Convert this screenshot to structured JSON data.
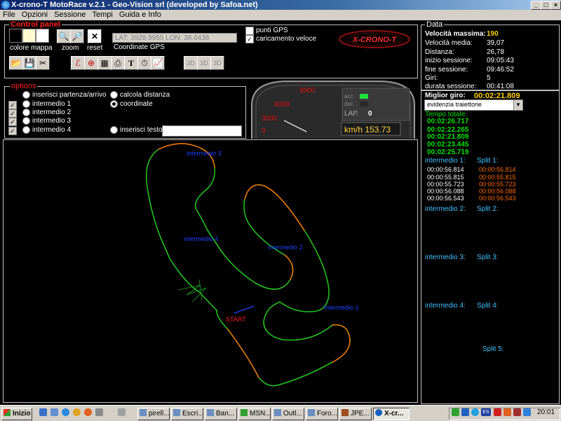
{
  "window": {
    "title": "X-crono-T MotoRace v.2.1 - Geo-Vision srl (developed by Safoa.net)"
  },
  "menu": [
    "File",
    "Opzioni",
    "Sessione",
    "Tempi",
    "Guida e Info"
  ],
  "control_panel": {
    "legend": "Control panel",
    "colore_mappa": "colore mappa",
    "zoom": "zoom",
    "reset": "reset",
    "coords_value": "LAT: 3928.9955 LON: 38.0438",
    "coords_label": "Coordinate GPS",
    "punti_gps": "punti GPS",
    "caricamento_veloce": "caricamento veloce",
    "swatch_colors": [
      "#000000",
      "#fffbd0",
      "#ffffff"
    ]
  },
  "options": {
    "legend": "options",
    "left": [
      "inserisci partenza/arrivo",
      "intermedio 1",
      "intermedio 2",
      "intermedio 3",
      "intermedio 4"
    ],
    "right": [
      "calcola distanza",
      "coordinate",
      "inserisci testo"
    ],
    "selected": "coordinate"
  },
  "gauge": {
    "scale": [
      "9000",
      "6000",
      "3000",
      "0"
    ],
    "acc": "acc",
    "dec": "dec",
    "lap_label": "LAP.",
    "lap_value": "0",
    "speed": "km/h 153.73"
  },
  "logo": "X-CRONO-T",
  "data": {
    "legend": "Data",
    "velocita_massima_label": "Velocità massima:",
    "velocita_massima": "190",
    "rows": [
      {
        "label": "Velocità media:",
        "value": "39,07"
      },
      {
        "label": "Distanza:",
        "value": "26,78"
      },
      {
        "label": "inizio sessione:",
        "value": "09:05:43"
      },
      {
        "label": "fine sessione:",
        "value": "09:46:52"
      },
      {
        "label": "Giri:",
        "value": "5"
      },
      {
        "label": "durata sessione:",
        "value": "00:41:08"
      }
    ],
    "miglior_giro_label": "Miglior giro:",
    "miglior_giro": "00:02:21.809",
    "select_value": "evidenzia traiettorie",
    "tempo_totale_label": "Tempo totale:",
    "tempi": [
      "00:02:26.717",
      "00:02:22.265",
      "00:02:21.809",
      "00:02:23.445",
      "00:02:25.719"
    ],
    "intermedio1_label": "intermedio 1:",
    "split1_label": "Split 1:",
    "intermedio1": [
      "00:00:56.814",
      "00:00:55.815",
      "00:00:55.723",
      "00:00:56.088",
      "00:00:56.543"
    ],
    "split1": [
      "00:00:56.814",
      "00:00:55.815",
      "00:00:55.723",
      "00:00:56.088",
      "00:00:56.543"
    ],
    "intermedio2_label": "intermedio 2:",
    "split2_label": "Split 2:",
    "intermedio3_label": "intermedio 3:",
    "split3_label": "Split 3:",
    "intermedio4_label": "intermedio 4:",
    "split4_label": "Split 4:",
    "split5_label": "Split 5:"
  },
  "track": {
    "labels": [
      "intermedio 3",
      "intermedio 4",
      "intermedio 2",
      "intermedio 1",
      "START"
    ]
  },
  "taskbar": {
    "start": "Inizio",
    "items": [
      "pirell...",
      "Escri...",
      "Ban...",
      "MSN...",
      "Outl...",
      "Foro...",
      "JPE...",
      "X-cr..."
    ],
    "tray_lang": "ES",
    "clock": "20:01"
  }
}
